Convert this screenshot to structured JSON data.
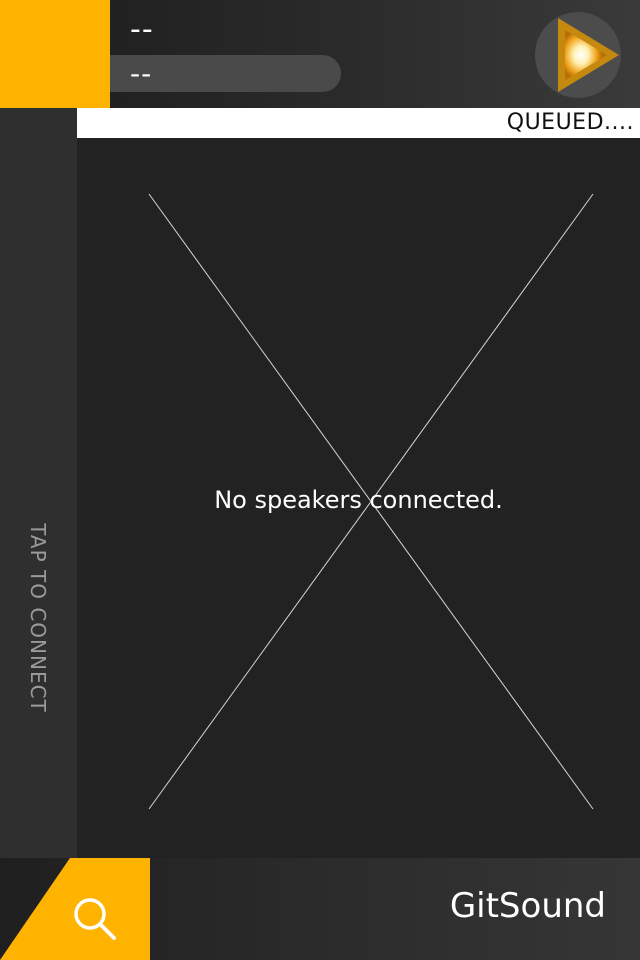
{
  "now_playing": {
    "title": "--",
    "subtitle": "--"
  },
  "queue": {
    "status": "QUEUED...."
  },
  "sidebar": {
    "connect_label": "TAP TO CONNECT"
  },
  "main": {
    "empty_message": "No speakers connected."
  },
  "footer": {
    "brand": "GitSound"
  },
  "icons": {
    "play": "play-icon",
    "search": "search-icon",
    "placeholder": "cross-placeholder"
  },
  "colors": {
    "accent": "#fdb300",
    "background": "#222222",
    "text": "#ffffff",
    "muted_text": "#9a9a9a"
  }
}
